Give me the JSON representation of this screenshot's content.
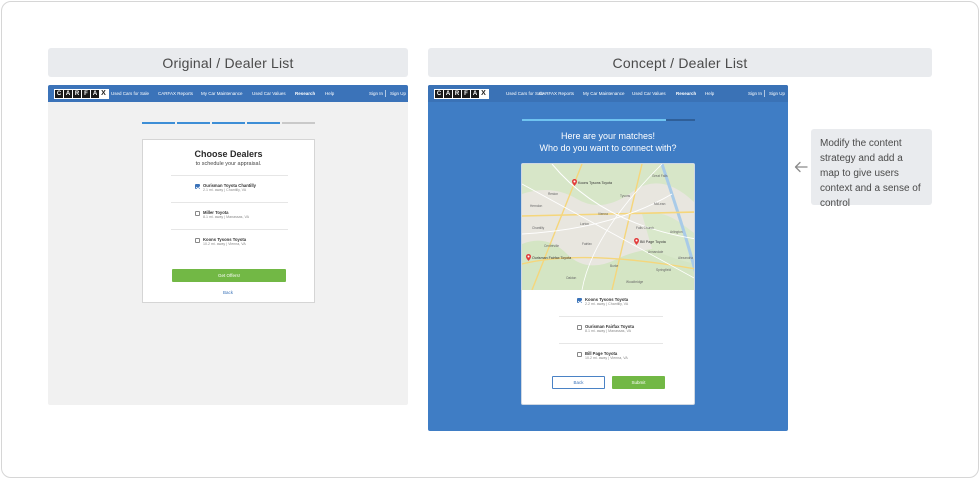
{
  "panels": {
    "original_title": "Original / Dealer List",
    "concept_title": "Concept / Dealer List"
  },
  "nav": {
    "logo_letters": [
      "C",
      "A",
      "R",
      "F",
      "A"
    ],
    "logo_mark": "X",
    "links": [
      "Used Cars for Sale",
      "CARFAX Reports",
      "My Car Maintenance",
      "Used Car Values",
      "Research",
      "Help"
    ],
    "sign_in": "Sign In",
    "sign_up": "Sign Up"
  },
  "original": {
    "title": "Choose Dealers",
    "subtitle": "to schedule your appraisal.",
    "dealers": [
      {
        "name": "Ourisman Toyota Chantilly",
        "meta": "2.1 mi. away  |  Chantilly, VA",
        "checked": true
      },
      {
        "name": "Miller Toyota",
        "meta": "8.1 mi. away  |  Manassas, VA",
        "checked": false
      },
      {
        "name": "Koons Tysons Toyota",
        "meta": "10.2 mi. away  |  Vienna, VA",
        "checked": false
      }
    ],
    "primary_button": "Get Offers!",
    "back_link": "Back"
  },
  "concept": {
    "heading_line1": "Here are your matches!",
    "heading_line2": "Who do you want to connect with?",
    "map": {
      "pins": [
        "Koons Tysons Toyota",
        "Bill Page Toyota",
        "Ourisman Fairfax Toyota"
      ],
      "place_labels": [
        "Reston",
        "Herndon",
        "Vienna",
        "Tysons",
        "McLean",
        "Fairfax",
        "Arlington",
        "Annandale",
        "Falls Church",
        "Chantilly",
        "Centreville",
        "Burke",
        "Springfield",
        "Oakton",
        "Great Falls",
        "Lorton",
        "Woodbridge",
        "Alexandria"
      ],
      "accent_color": "#e23c3c"
    },
    "dealers": [
      {
        "name": "Koons Tysons Toyota",
        "meta": "2.2 mi. away  |  Chantilly, VA",
        "checked": true
      },
      {
        "name": "Ourisman Fairfax Toyota",
        "meta": "8.1 mi. away  |  Manassas, VA",
        "checked": false
      },
      {
        "name": "Bill Page Toyota",
        "meta": "10.2 mi. away  |  Vienna, VA",
        "checked": false
      }
    ],
    "back_button": "Back",
    "submit_button": "Submit"
  },
  "annotation": {
    "text": "Modify the content strategy and add a map to give users context and a sense of control",
    "arrow_icon": "arrow-left-icon"
  },
  "colors": {
    "carfax_blue": "#3b73b9",
    "concept_bg": "#3f7dc5",
    "cta_green": "#72b845",
    "panel_gray": "#e9ebee"
  }
}
